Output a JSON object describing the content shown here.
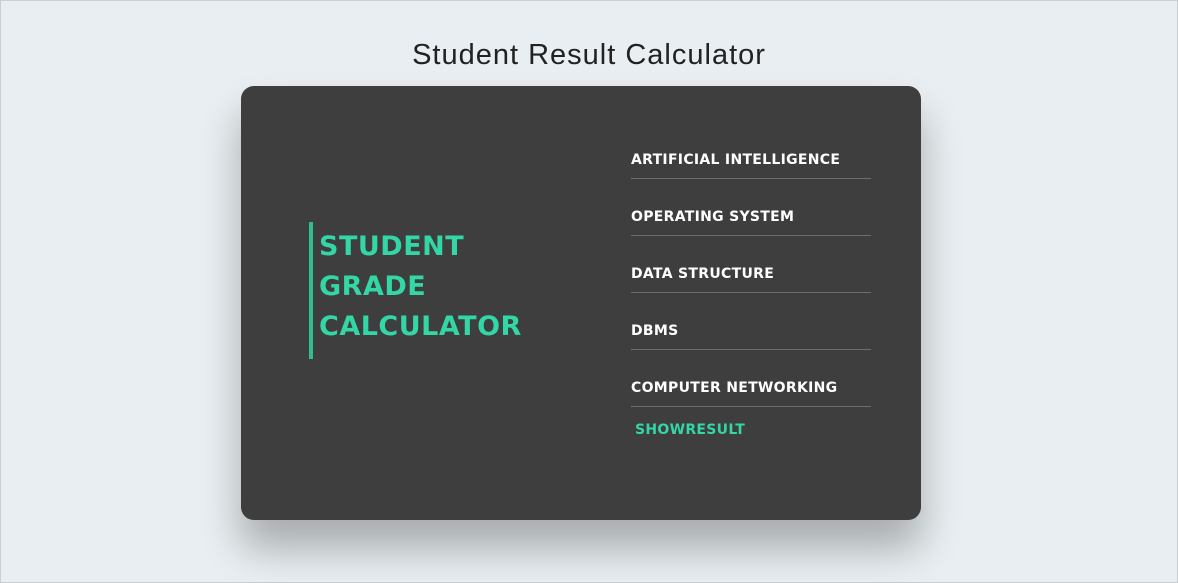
{
  "page": {
    "title": "Student Result Calculator"
  },
  "brand": {
    "lines": [
      "STUDENT",
      "GRADE",
      "CALCULATOR"
    ],
    "accent_color": "#2fbf8f",
    "text_color": "#33d6a5"
  },
  "subjects": [
    {
      "placeholder": "ARTIFICIAL INTELLIGENCE",
      "value": ""
    },
    {
      "placeholder": "OPERATING SYSTEM",
      "value": ""
    },
    {
      "placeholder": "DATA STRUCTURE",
      "value": ""
    },
    {
      "placeholder": "DBMS",
      "value": ""
    },
    {
      "placeholder": "COMPUTER NETWORKING",
      "value": ""
    }
  ],
  "actions": {
    "show_result_label": "SHOWRESULT"
  },
  "colors": {
    "background": "#e8eef1",
    "card": "#3e3e3e",
    "field_text": "#ffffff",
    "field_underline": "#6e6e6e"
  }
}
